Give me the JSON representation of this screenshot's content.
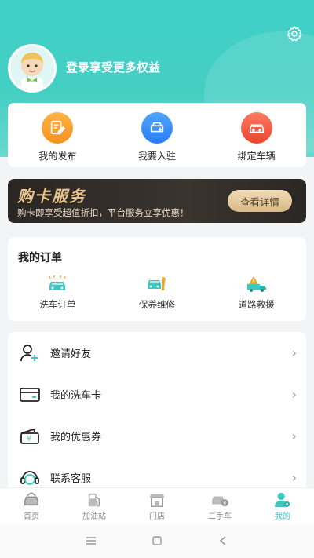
{
  "header": {
    "login_prompt": "登录享受更多权益"
  },
  "quick_actions": [
    {
      "label": "我的发布",
      "icon": "edit-doc-icon",
      "color": "#f7911e"
    },
    {
      "label": "我要入驻",
      "icon": "car-add-icon",
      "color": "#2a7cf4"
    },
    {
      "label": "绑定车辆",
      "icon": "car-icon",
      "color": "#e9452f"
    }
  ],
  "banner": {
    "title": "购卡服务",
    "subtitle": "购卡即享受超值折扣，平台服务立享优惠！",
    "button": "查看详情"
  },
  "orders": {
    "title": "我的订单",
    "items": [
      {
        "label": "洗车订单",
        "icon": "car-wash-icon"
      },
      {
        "label": "保养维修",
        "icon": "maintenance-icon"
      },
      {
        "label": "道路救援",
        "icon": "road-rescue-icon"
      }
    ]
  },
  "menu": [
    {
      "label": "邀请好友",
      "icon": "add-friend-icon"
    },
    {
      "label": "我的洗车卡",
      "icon": "card-icon"
    },
    {
      "label": "我的优惠券",
      "icon": "coupon-icon"
    },
    {
      "label": "联系客服",
      "icon": "customer-service-icon"
    }
  ],
  "tabbar": [
    {
      "label": "首页",
      "icon": "home-car-icon"
    },
    {
      "label": "加油站",
      "icon": "gas-station-icon"
    },
    {
      "label": "门店",
      "icon": "store-icon"
    },
    {
      "label": "二手车",
      "icon": "used-car-icon"
    },
    {
      "label": "我的",
      "icon": "profile-icon",
      "active": true
    }
  ],
  "colors": {
    "accent": "#3ec6c1",
    "header": "#45cfc3"
  }
}
